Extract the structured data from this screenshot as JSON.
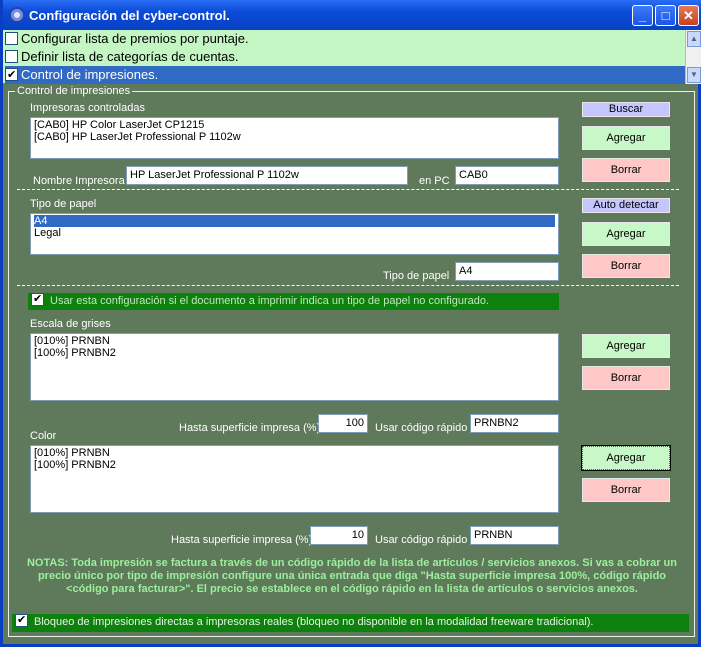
{
  "window": {
    "title": "Configuración del cyber-control.",
    "buttons": {
      "minimize": "_",
      "maximize": "□",
      "close": "✕"
    }
  },
  "top_list": {
    "items": [
      {
        "label": "Configurar lista de premios por puntaje.",
        "checked": false
      },
      {
        "label": "Definir lista de categorías de cuentas.",
        "checked": false
      },
      {
        "label": "Control de impresiones.",
        "checked": true
      }
    ]
  },
  "frame": {
    "legend": "Control de impresiones"
  },
  "printers": {
    "label": "Impresoras controladas",
    "items": [
      "[CAB0] HP Color LaserJet CP1215",
      "[CAB0] HP LaserJet Professional P 1102w"
    ],
    "name_label": "Nombre Impresora",
    "name_value": "HP LaserJet Professional P 1102w",
    "pc_label": "en PC",
    "pc_value": "CAB0",
    "buscar": "Buscar",
    "agregar": "Agregar",
    "borrar": "Borrar"
  },
  "paper": {
    "label": "Tipo de papel",
    "items": [
      "A4",
      "Legal"
    ],
    "selected": "A4",
    "type_label": "Tipo de papel",
    "type_value": "A4",
    "auto": "Auto detectar",
    "agregar": "Agregar",
    "borrar": "Borrar"
  },
  "use_config": "Usar esta configuración si el documento a imprimir indica un tipo de papel no configurado.",
  "grayscale": {
    "label": "Escala de grises",
    "items": [
      "[010%] PRNBN",
      "[100%] PRNBN2"
    ],
    "agregar": "Agregar",
    "borrar": "Borrar",
    "surface_label": "Hasta superficie impresa (%)",
    "surface_value": "100",
    "code_label": "Usar código rápido",
    "code_value": "PRNBN2"
  },
  "color": {
    "label": "Color",
    "items": [
      "[010%] PRNBN",
      "[100%] PRNBN2"
    ],
    "agregar": "Agregar",
    "borrar": "Borrar",
    "surface_label": "Hasta superficie impresa (%)",
    "surface_value": "10",
    "code_label": "Usar código rápido",
    "code_value": "PRNBN"
  },
  "notes": "NOTAS: Toda impresión se factura a través de un código rápido de la lista de artículos / servicios anexos. Si vas a cobrar un precio único por tipo de impresión configure una única entrada que diga \"Hasta superficie impresa 100%, código rápido <código para facturar>\". El precio se establece en el código rápido en la lista de artículos o servicios anexos.",
  "block_direct": "Bloqueo de impresiones directas a impresoras reales (bloqueo no disponible en la modalidad freeware tradicional)."
}
